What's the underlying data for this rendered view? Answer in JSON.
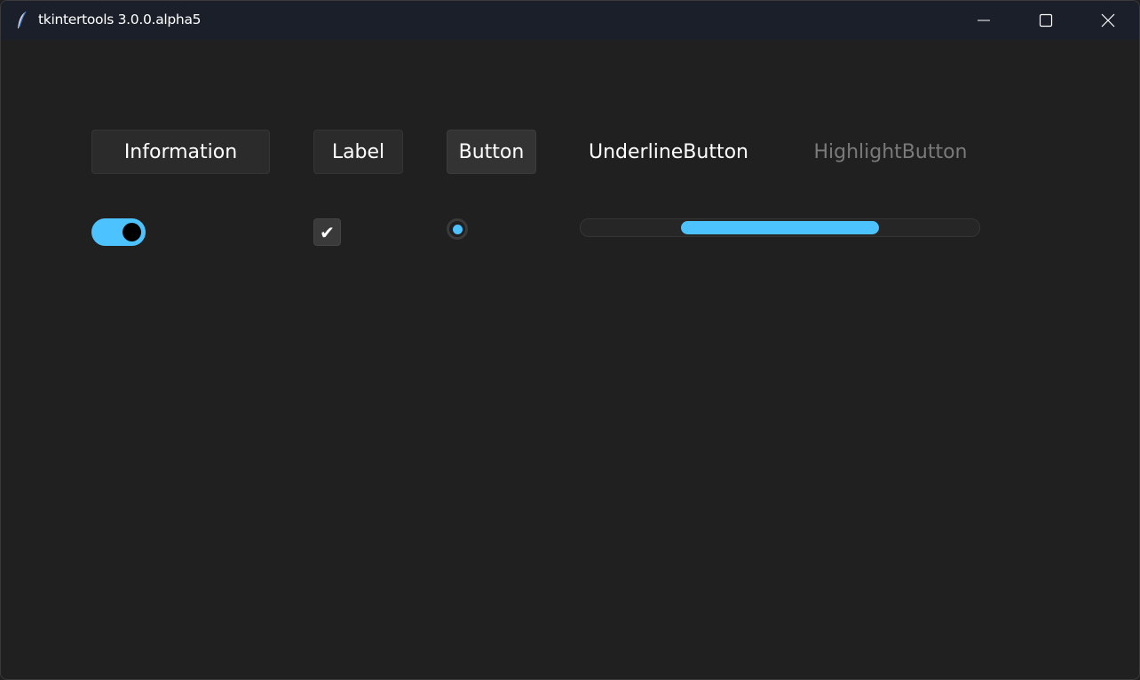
{
  "window": {
    "title": "tkintertools 3.0.0.alpha5",
    "app_icon": "feather-icon",
    "controls": [
      "minimize-icon",
      "maximize-icon",
      "close-icon"
    ]
  },
  "widgets": {
    "information": {
      "text": "Information"
    },
    "label": {
      "text": "Label"
    },
    "button": {
      "text": "Button"
    },
    "underline_button": {
      "text": "UnderlineButton"
    },
    "highlight_button": {
      "text": "HighlightButton"
    },
    "switch": {
      "on": true
    },
    "checkbox": {
      "checked": true,
      "glyph": "✔"
    },
    "radio": {
      "selected": true
    },
    "progress": {
      "start_fraction": 0.25,
      "end_fraction": 0.75
    }
  },
  "colors": {
    "accent": "#4cc2ff",
    "background": "#202020",
    "titlebar": "#1b1f2a",
    "text": "#ffffff",
    "text_disabled": "#7a7a7a"
  }
}
